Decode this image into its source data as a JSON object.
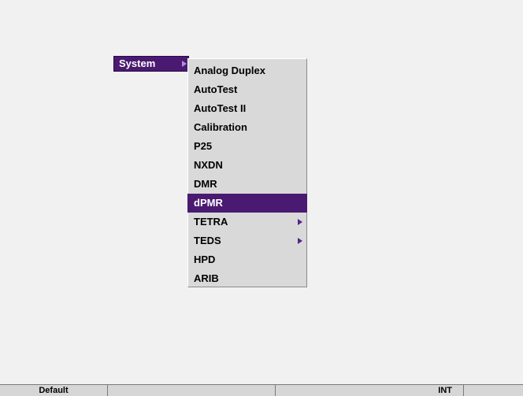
{
  "system_button": {
    "label": "System"
  },
  "menu": {
    "items": [
      {
        "label": "Analog Duplex",
        "selected": false,
        "submenu": false
      },
      {
        "label": "AutoTest",
        "selected": false,
        "submenu": false
      },
      {
        "label": "AutoTest II",
        "selected": false,
        "submenu": false
      },
      {
        "label": "Calibration",
        "selected": false,
        "submenu": false
      },
      {
        "label": "P25",
        "selected": false,
        "submenu": false
      },
      {
        "label": "NXDN",
        "selected": false,
        "submenu": false
      },
      {
        "label": "DMR",
        "selected": false,
        "submenu": false
      },
      {
        "label": "dPMR",
        "selected": true,
        "submenu": false
      },
      {
        "label": "TETRA",
        "selected": false,
        "submenu": true
      },
      {
        "label": "TEDS",
        "selected": false,
        "submenu": true
      },
      {
        "label": "HPD",
        "selected": false,
        "submenu": false
      },
      {
        "label": "ARIB",
        "selected": false,
        "submenu": false
      }
    ]
  },
  "statusbar": {
    "left": "Default",
    "middle": "",
    "right": "INT"
  },
  "colors": {
    "accent": "#4a1a72",
    "menu_bg": "#d9d9d9",
    "page_bg": "#f1f1f1"
  },
  "icons": {
    "submenu_arrow": "triangle-right-icon"
  }
}
